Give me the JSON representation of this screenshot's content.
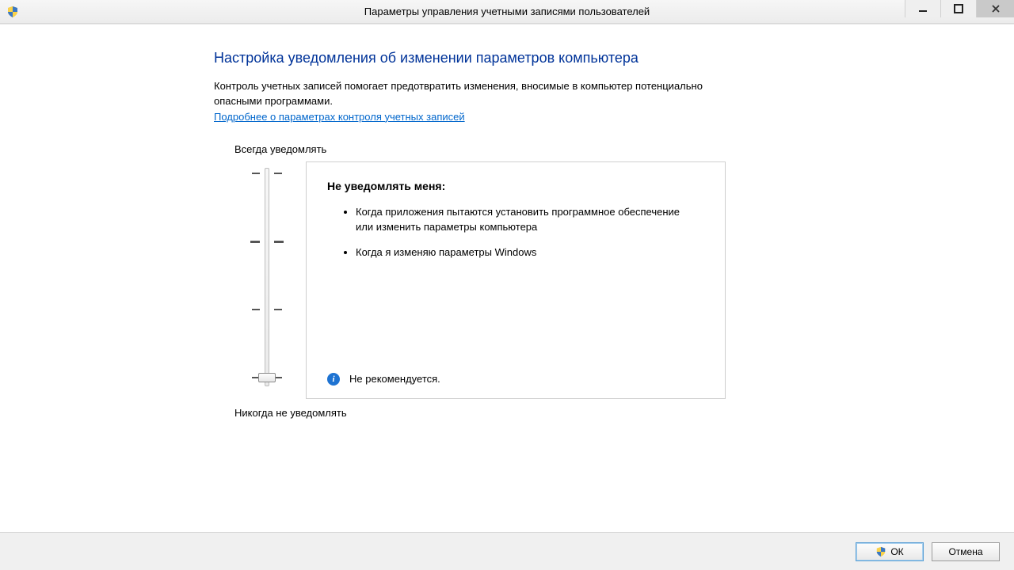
{
  "window": {
    "title": "Параметры управления учетными записями пользователей"
  },
  "page": {
    "heading": "Настройка уведомления об изменении параметров компьютера",
    "description": "Контроль учетных записей помогает предотвратить изменения, вносимые в компьютер потенциально опасными программами.",
    "learn_more": "Подробнее о параметрах контроля учетных записей"
  },
  "slider": {
    "top_label": "Всегда уведомлять",
    "bottom_label": "Никогда не уведомлять",
    "levels": 4,
    "current_level": 0
  },
  "info_panel": {
    "title": "Не уведомлять меня:",
    "items": [
      "Когда приложения пытаются установить программное обеспечение или изменить параметры компьютера",
      "Когда я изменяю параметры Windows"
    ],
    "recommendation": "Не рекомендуется."
  },
  "footer": {
    "ok": "ОК",
    "cancel": "Отмена"
  }
}
